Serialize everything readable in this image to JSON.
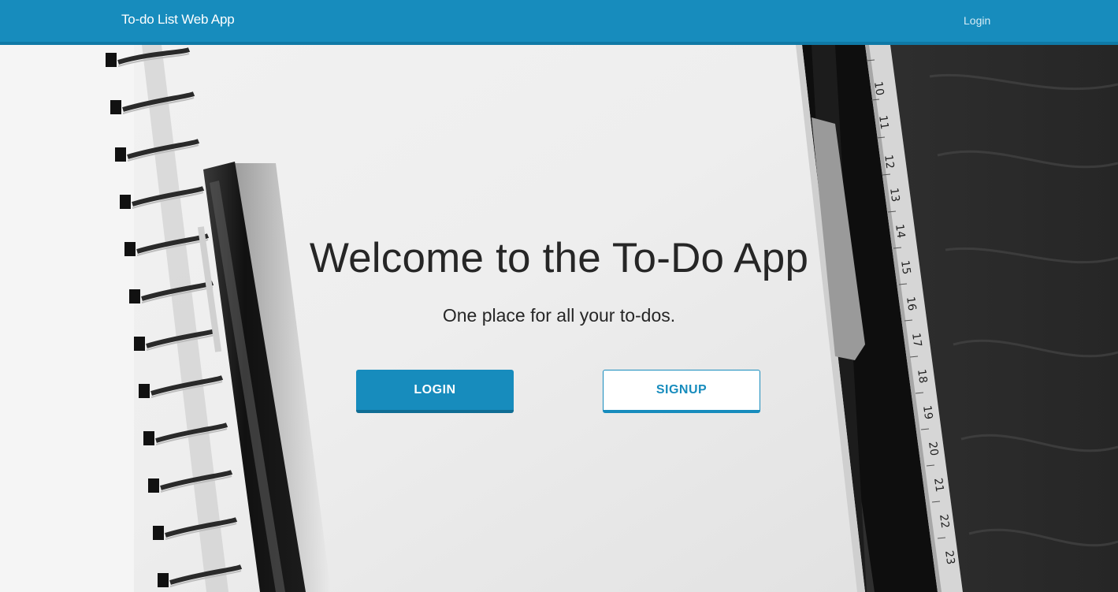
{
  "navbar": {
    "brand": "To-do List Web App",
    "login_link": "Login"
  },
  "hero": {
    "title": "Welcome to the To-Do App",
    "subtitle": "One place for all your to-dos.",
    "login_button": "LOGIN",
    "signup_button": "SIGNUP",
    "background_image": "notebook-with-pen-and-ruler",
    "ruler_numbers": [
      "10",
      "11",
      "12",
      "13",
      "14",
      "15",
      "16",
      "17",
      "18",
      "19",
      "20",
      "21",
      "22",
      "23"
    ]
  },
  "colors": {
    "primary": "#178cbd",
    "primary_dark": "#0f79a6",
    "text": "#262626"
  }
}
